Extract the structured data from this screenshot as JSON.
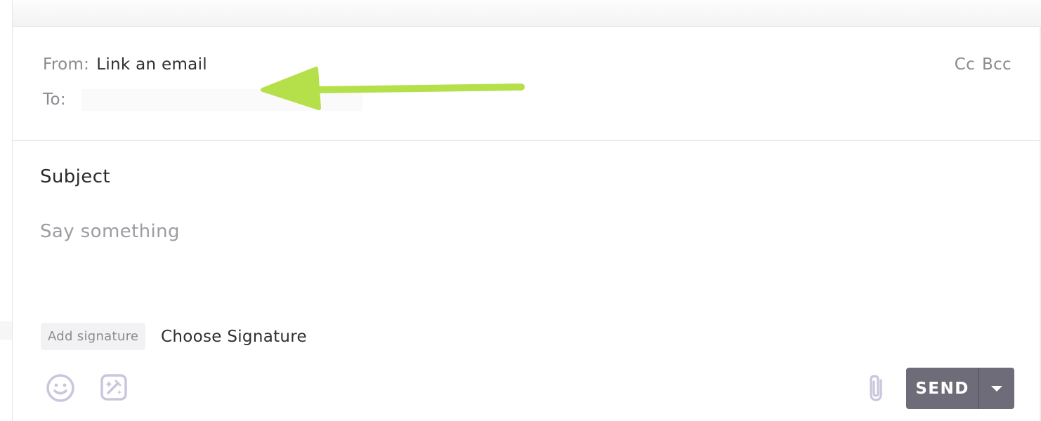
{
  "header": {
    "from_label": "From:",
    "from_value": "Link an email",
    "to_label": "To:",
    "to_value": "",
    "cc_label": "Cc",
    "bcc_label": "Bcc"
  },
  "composer": {
    "subject": "Subject",
    "body_placeholder": "Say something"
  },
  "signature": {
    "badge_label": "Add signature",
    "choose_label": "Choose Signature"
  },
  "toolbar": {
    "emoji_icon": "smiley-icon",
    "magic_icon": "magic-wand-icon",
    "attach_icon": "paperclip-icon",
    "send_label": "SEND",
    "send_dropdown_icon": "caret-down-icon"
  },
  "colors": {
    "arrow": "#b5e04a",
    "send_button": "#6d6c78",
    "icon": "#c9c6dd"
  }
}
